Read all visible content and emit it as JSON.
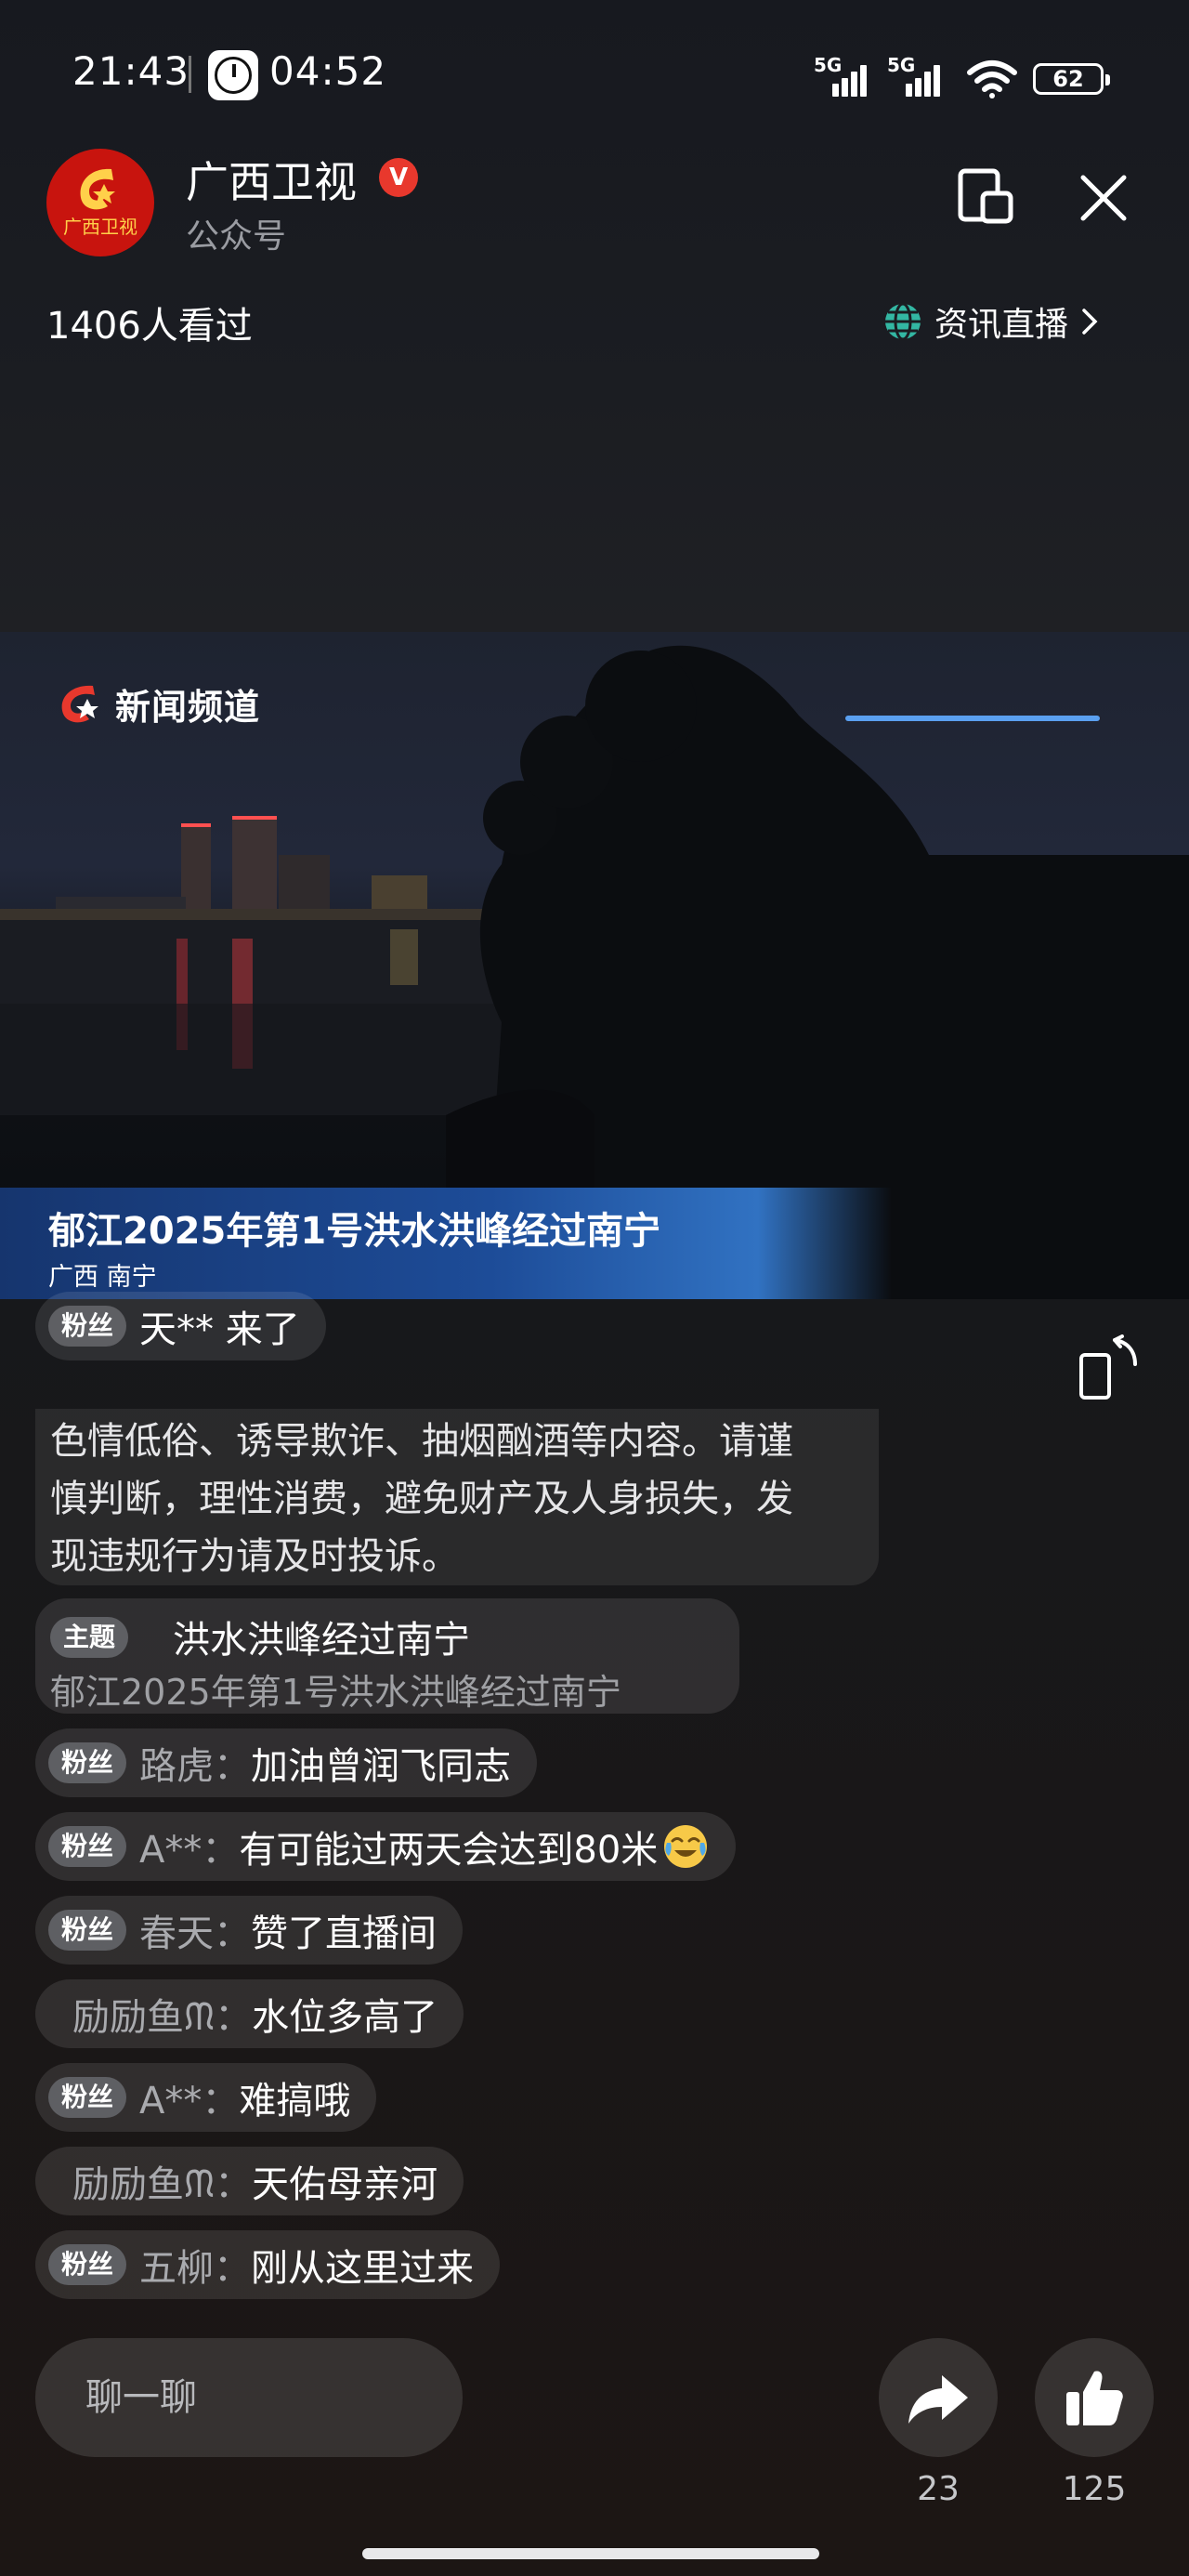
{
  "status_bar": {
    "time": "21:43",
    "timer": "04:52",
    "network1": "5G",
    "network2": "5G",
    "battery": "62"
  },
  "header": {
    "avatar_text": "广西卫视",
    "channel_name": "广西卫视",
    "verified_mark": "V",
    "channel_type": "公众号",
    "viewers": "1406人看过",
    "news_link": "资讯直播"
  },
  "video": {
    "logo_text": "新闻频道",
    "banner_title": "郁江2025年第1号洪水洪峰经过南宁",
    "banner_subtitle": "广西 南宁"
  },
  "chat": {
    "first_message": {
      "badge": "粉丝",
      "text": "天** 来了"
    },
    "notice_lines": [
      "色情低俗、诱导欺诈、抽烟酗酒等内容。请谨",
      "慎判断，理性消费，避免财产及人身损失，发",
      "现违规行为请及时投诉。"
    ],
    "topic": {
      "badge": "主题",
      "title": "洪水洪峰经过南宁",
      "subtitle": "郁江2025年第1号洪水洪峰经过南宁"
    },
    "messages": [
      {
        "badge": "粉丝",
        "user": "路虎：",
        "text": "加油曾润飞同志"
      },
      {
        "badge": "粉丝",
        "user": "A**：",
        "text": "有可能过两天会达到80米"
      },
      {
        "badge": "粉丝",
        "user": "春天：",
        "text": "赞了直播间"
      },
      {
        "badge": "",
        "user": "励励鱼ᙏ：",
        "text": "水位多高了"
      },
      {
        "badge": "粉丝",
        "user": "A**：",
        "text": "难搞哦"
      },
      {
        "badge": "",
        "user": "励励鱼ᙏ：",
        "text": "天佑母亲河"
      },
      {
        "badge": "粉丝",
        "user": "五柳：",
        "text": "刚从这里过来"
      }
    ]
  },
  "bottom": {
    "input_placeholder": "聊一聊",
    "share_count": "23",
    "like_count": "125"
  },
  "colors": {
    "badge_red": "#e8382d",
    "video_banner": "#1d4c98",
    "progress_blue": "#5aa0f0"
  },
  "icons": [
    "clock-icon",
    "signal-icon",
    "wifi-icon",
    "battery-icon",
    "verified-icon",
    "picture-in-picture-icon",
    "close-icon",
    "globe-icon",
    "chevron-right-icon",
    "rotate-screen-icon",
    "share-icon",
    "like-icon",
    "laugh-cry-emoji-icon"
  ]
}
